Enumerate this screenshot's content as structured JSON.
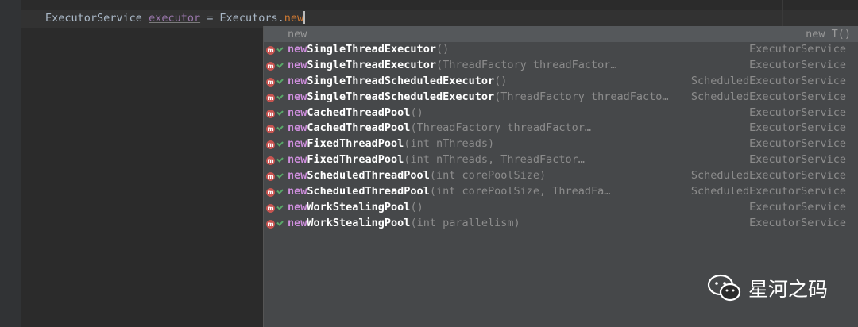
{
  "editor": {
    "code_type": "ExecutorService",
    "code_var": "executor",
    "code_eq": " = ",
    "code_class": "Executors.",
    "code_typed": "new"
  },
  "popup": {
    "header_left": "new",
    "header_right": "new T()",
    "items": [
      {
        "prefix": "new",
        "name": "SingleThreadExecutor",
        "params": "()",
        "type": "ExecutorService"
      },
      {
        "prefix": "new",
        "name": "SingleThreadExecutor",
        "params": "(ThreadFactory threadFactory)",
        "type": "ExecutorService"
      },
      {
        "prefix": "new",
        "name": "SingleThreadScheduledExecutor",
        "params": "()",
        "type": "ScheduledExecutorService"
      },
      {
        "prefix": "new",
        "name": "SingleThreadScheduledExecutor",
        "params": "(ThreadFactory threadFacto…",
        "type": "ScheduledExecutorService"
      },
      {
        "prefix": "new",
        "name": "CachedThreadPool",
        "params": "()",
        "type": "ExecutorService"
      },
      {
        "prefix": "new",
        "name": "CachedThreadPool",
        "params": "(ThreadFactory threadFactory)",
        "type": "ExecutorService"
      },
      {
        "prefix": "new",
        "name": "FixedThreadPool",
        "params": "(int nThreads)",
        "type": "ExecutorService"
      },
      {
        "prefix": "new",
        "name": "FixedThreadPool",
        "params": "(int nThreads, ThreadFactory threadFactory)",
        "type": "ExecutorService"
      },
      {
        "prefix": "new",
        "name": "ScheduledThreadPool",
        "params": "(int corePoolSize)",
        "type": "ScheduledExecutorService"
      },
      {
        "prefix": "new",
        "name": "ScheduledThreadPool",
        "params": "(int corePoolSize, ThreadFactory thr…",
        "type": "ScheduledExecutorService"
      },
      {
        "prefix": "new",
        "name": "WorkStealingPool",
        "params": "()",
        "type": "ExecutorService"
      },
      {
        "prefix": "new",
        "name": "WorkStealingPool",
        "params": "(int parallelism)",
        "type": "ExecutorService"
      }
    ]
  },
  "watermark": {
    "text": "星河之码"
  },
  "colors": {
    "background": "#2b2b2b",
    "popup": "#46484a",
    "match_prefix": "#cf8fde",
    "method_icon": "#c75450"
  },
  "icons": {
    "item_icon": "method-icon",
    "visibility_icon": "public-visibility-icon",
    "watermark_icon": "wechat-icon"
  }
}
